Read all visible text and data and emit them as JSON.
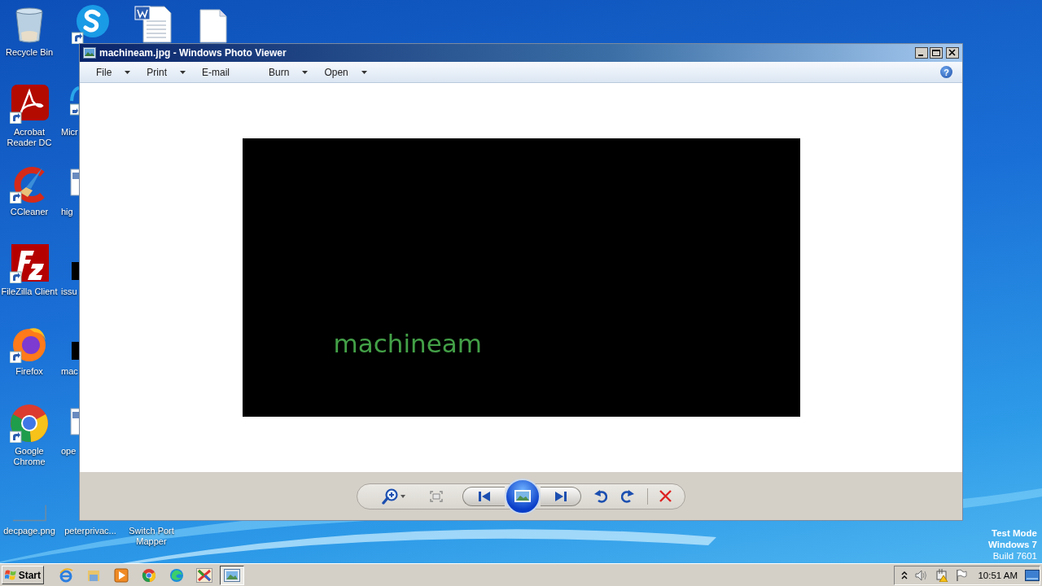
{
  "desktop": {
    "icons": [
      {
        "kind": "recycle-bin",
        "label": "Recycle Bin"
      },
      {
        "kind": "acrobat",
        "label": "Acrobat Reader DC"
      },
      {
        "kind": "ccleaner",
        "label": "CCleaner"
      },
      {
        "kind": "filezilla",
        "label": "FileZilla Client"
      },
      {
        "kind": "firefox",
        "label": "Firefox"
      },
      {
        "kind": "chrome",
        "label": "Google Chrome"
      },
      {
        "kind": "image-file",
        "label": "decpage.png"
      },
      {
        "kind": "skype"
      },
      {
        "kind": "browser-part",
        "label": "Micr"
      },
      {
        "kind": "document-part",
        "label": "hig"
      },
      {
        "kind": "black-part",
        "label": "issu"
      },
      {
        "kind": "black-part",
        "label": "mac"
      },
      {
        "kind": "document-part",
        "label": "ope"
      },
      {
        "kind": "none",
        "label": "peterprivac..."
      },
      {
        "kind": "word-doc"
      },
      {
        "kind": "none",
        "label": "Switch Port Mapper"
      },
      {
        "kind": "blank-doc"
      }
    ],
    "watermark": [
      "Test Mode",
      "Windows 7",
      "Build 7601"
    ]
  },
  "window": {
    "title": "machineam.jpg - Windows Photo Viewer",
    "toolbar": [
      {
        "label": "File",
        "dropdown": true
      },
      {
        "label": "Print",
        "dropdown": true
      },
      {
        "label": "E-mail",
        "dropdown": false
      },
      {
        "label": "Burn",
        "dropdown": true
      },
      {
        "label": "Open",
        "dropdown": true
      }
    ],
    "help": "?",
    "image_text": "machineam"
  },
  "taskbar": {
    "start": "Start",
    "apps": [
      {
        "kind": "ie",
        "selected": false
      },
      {
        "kind": "explorer",
        "selected": false
      },
      {
        "kind": "media",
        "selected": false
      },
      {
        "kind": "chrome",
        "selected": false
      },
      {
        "kind": "edge",
        "selected": false
      },
      {
        "kind": "xapp",
        "selected": false
      },
      {
        "kind": "photo-viewer",
        "selected": true
      }
    ],
    "clock": "10:51 AM"
  }
}
